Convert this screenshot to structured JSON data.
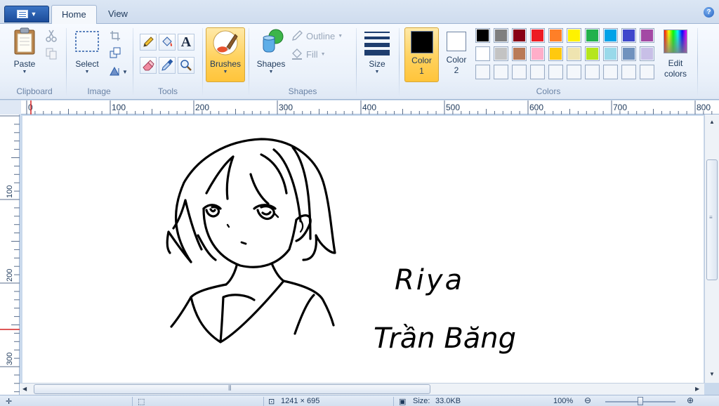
{
  "tabs": {
    "home": "Home",
    "view": "View"
  },
  "clipboard": {
    "paste": "Paste",
    "group": "Clipboard"
  },
  "image": {
    "select": "Select",
    "group": "Image"
  },
  "tools": {
    "group": "Tools",
    "text_tool_glyph": "A"
  },
  "brushes": {
    "label": "Brushes"
  },
  "shapes": {
    "label": "Shapes",
    "outline": "Outline",
    "fill": "Fill",
    "group": "Shapes"
  },
  "size": {
    "label": "Size"
  },
  "colors": {
    "color1_label": "Color",
    "color1_num": "1",
    "color2_label": "Color",
    "color2_num": "2",
    "edit_label": "Edit",
    "edit_label2": "colors",
    "group": "Colors",
    "color1": "#000000",
    "color2": "#ffffff",
    "palette_row1": [
      "#000000",
      "#7f7f7f",
      "#880015",
      "#ed1c24",
      "#ff7f27",
      "#fff200",
      "#22b14c",
      "#00a2e8",
      "#3f48cc",
      "#a349a4"
    ],
    "palette_row2": [
      "#ffffff",
      "#c3c3c3",
      "#b97a57",
      "#ffaec9",
      "#ffc90e",
      "#efe4b0",
      "#b5e61d",
      "#99d9ea",
      "#7092be",
      "#c8bfe7"
    ]
  },
  "ruler": {
    "h_labels": [
      "0",
      "100",
      "200",
      "300",
      "400",
      "500",
      "600",
      "700",
      "800"
    ],
    "v_labels": [
      "100",
      "200",
      "300"
    ]
  },
  "drawing": {
    "handwriting_line1": "Riya",
    "handwriting_line2": "Trần Băng"
  },
  "status": {
    "cursor_pos": "1241 × 695",
    "size_prefix": "Size:",
    "size_value": "33.0KB",
    "zoom": "100%"
  }
}
